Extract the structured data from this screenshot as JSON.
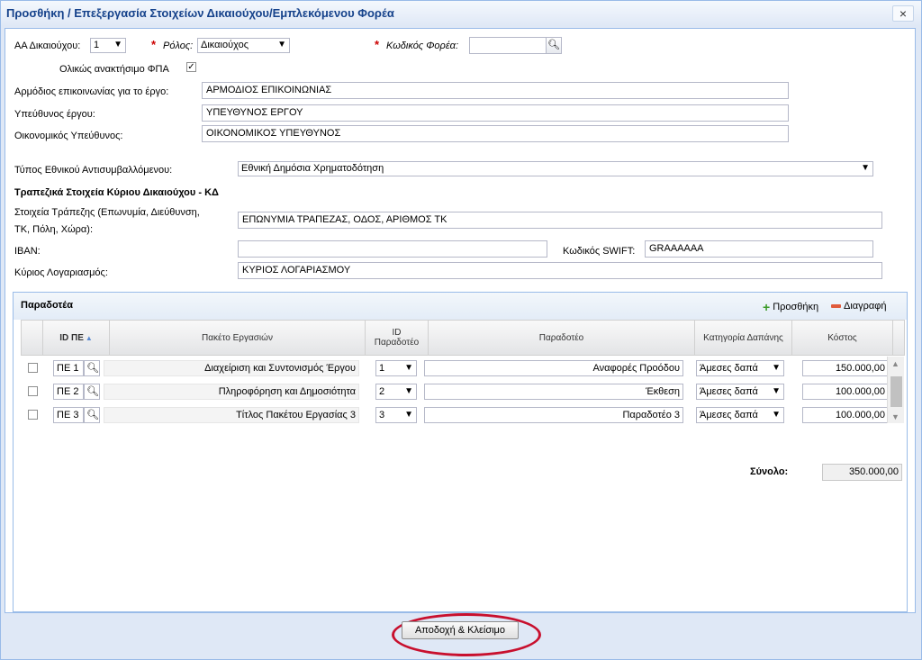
{
  "window": {
    "title": "Προσθήκη / Επεξεργασία Στοιχείων Δικαιούχου/Εμπλεκόμενου Φορέα",
    "close": "×"
  },
  "form": {
    "aa_label": "ΑΑ Δικαιούχου:",
    "aa_value": "1",
    "role_label": "Ρόλος:",
    "role_value": "Δικαιούχος",
    "code_label": "Κωδικός Φορέα:",
    "code_value": "",
    "vat_label": "Ολικώς ανακτήσιμο ΦΠΑ",
    "vat_checked": "✓",
    "contact_label": "Αρμόδιος επικοινωνίας για το έργο:",
    "contact_value": "ΑΡΜΟΔΙΟΣ ΕΠΙΚΟΙΝΩΝΙΑΣ",
    "manager_label": "Υπεύθυνος έργου:",
    "manager_value": "ΥΠΕΥΘΥΝΟΣ ΕΡΓΟΥ",
    "finance_label": "Οικονομικός Υπεύθυνος:",
    "finance_value": "ΟΙΚΟΝΟΜΙΚΟΣ ΥΠΕΥΘΥΝΟΣ",
    "national_type_label": "Τύπος Εθνικού Αντισυμβαλλόμενου:",
    "national_type_value": "Εθνική Δημόσια Χρηματοδότηση"
  },
  "bank": {
    "section_title": "Τραπεζικά Στοιχεία Κύριου Δικαιούχου - ΚΔ",
    "bank_label_1": "Στοιχεία Τράπεζης (Επωνυμία, Διεύθυνση,",
    "bank_label_2": "ΤΚ, Πόλη, Χώρα):",
    "bank_value": "ΕΠΩΝΥΜΙΑ ΤΡΑΠΕΖΑΣ, ΟΔΟΣ, ΑΡΙΘΜΟΣ ΤΚ",
    "iban_label": "IBAN:",
    "iban_value": "",
    "swift_label": "Κωδικός SWIFT:",
    "swift_value": "GRAAAAAA",
    "holder_label": "Κύριος Λογαριασμός:",
    "holder_value": "ΚΥΡΙΟΣ ΛΟΓΑΡΙΑΣΜΟΥ"
  },
  "deliverables": {
    "panel_title": "Παραδοτέα",
    "add_label": "Προσθήκη",
    "delete_label": "Διαγραφή",
    "columns": {
      "id_pe": "ID ΠΕ",
      "package": "Πακέτο Εργασιών",
      "id_deliv_1": "ID",
      "id_deliv_2": "Παραδοτέο",
      "deliverable": "Παραδοτέο",
      "category": "Κατηγορία Δαπάνης",
      "cost": "Κόστος"
    },
    "rows": [
      {
        "id_pe": "ΠΕ 1",
        "package": "Διαχείριση και Συντονισμός Έργου",
        "id_deliv": "1",
        "deliverable": "Αναφορές Προόδου",
        "category": "Άμεσες δαπά",
        "cost": "150.000,00"
      },
      {
        "id_pe": "ΠΕ 2",
        "package": "Πληροφόρηση και Δημοσιότητα",
        "id_deliv": "2",
        "deliverable": "Έκθεση",
        "category": "Άμεσες δαπά",
        "cost": "100.000,00"
      },
      {
        "id_pe": "ΠΕ 3",
        "package": "Τίτλος Πακέτου Εργασίας 3",
        "id_deliv": "3",
        "deliverable": "Παραδοτέο 3",
        "category": "Άμεσες δαπά",
        "cost": "100.000,00"
      }
    ],
    "total_label": "Σύνολο:",
    "total_value": "350.000,00"
  },
  "footer": {
    "accept_label": "Αποδοχή & Κλείσιμο"
  },
  "colors": {
    "title": "#15428b",
    "highlight_ellipse": "#c8102e",
    "required": "#cc0000"
  }
}
